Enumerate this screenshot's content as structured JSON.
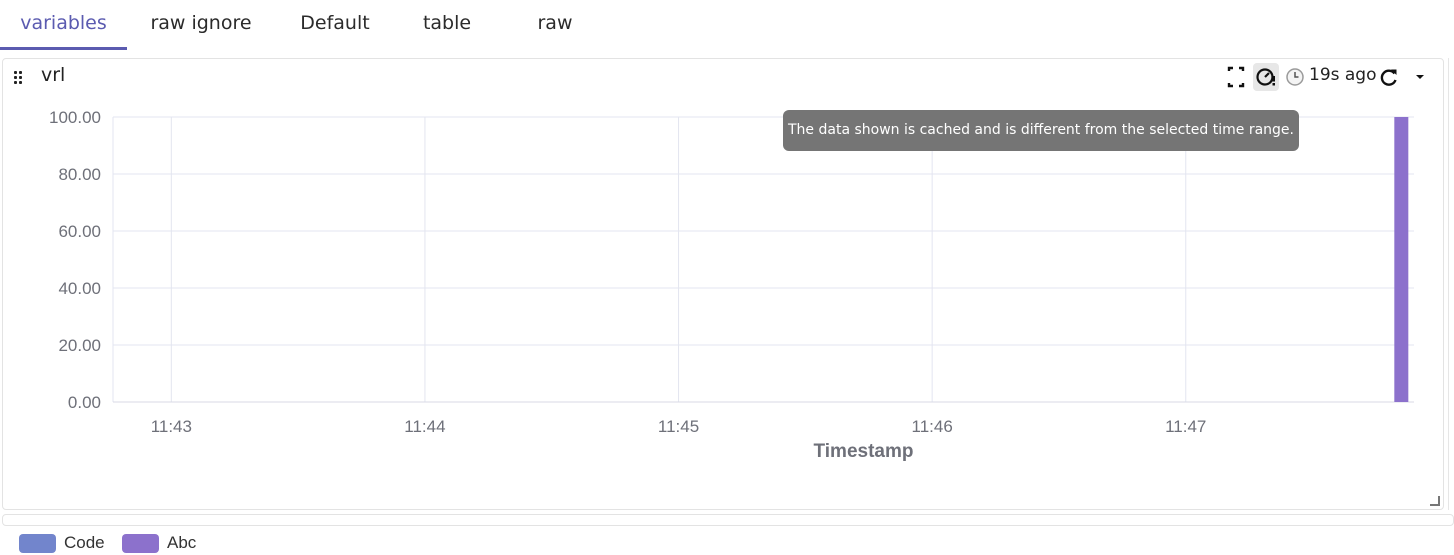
{
  "tabs": [
    {
      "label": "variables",
      "active": true
    },
    {
      "label": "raw ignore",
      "active": false
    },
    {
      "label": "Default",
      "active": false
    },
    {
      "label": "table",
      "active": false
    },
    {
      "label": "raw",
      "active": false
    }
  ],
  "panel": {
    "title": "vrl",
    "toolbar": {
      "fullscreen_icon": "expand-icon",
      "cache_icon": "cached-data-icon",
      "clock_icon": "clock-icon",
      "last_updated": "19s ago",
      "refresh_icon": "refresh-icon",
      "menu_icon": "chevron-down-icon"
    },
    "tooltip": "The data shown is cached and is different from the selected time range."
  },
  "colors": {
    "accent": "#5b5bb0",
    "code_series": "#7285cc",
    "abc_series": "#8c71cc"
  },
  "chart_data": {
    "type": "bar",
    "xlabel": "Timestamp",
    "ylabel": "",
    "ylim": [
      0,
      100
    ],
    "y_ticks": [
      "100.00",
      "80.00",
      "60.00",
      "40.00",
      "20.00",
      "0.00"
    ],
    "x_ticks": [
      "11:43",
      "11:44",
      "11:45",
      "11:46",
      "11:47"
    ],
    "x_range": [
      "11:42.77",
      "11:47.90"
    ],
    "grid": true,
    "legend_position": "bottom-left",
    "series": [
      {
        "name": "Code",
        "color": "#7285cc",
        "points": []
      },
      {
        "name": "Abc",
        "color": "#8c71cc",
        "points": [
          {
            "x": "11:47.85",
            "y": 100
          }
        ]
      }
    ]
  }
}
